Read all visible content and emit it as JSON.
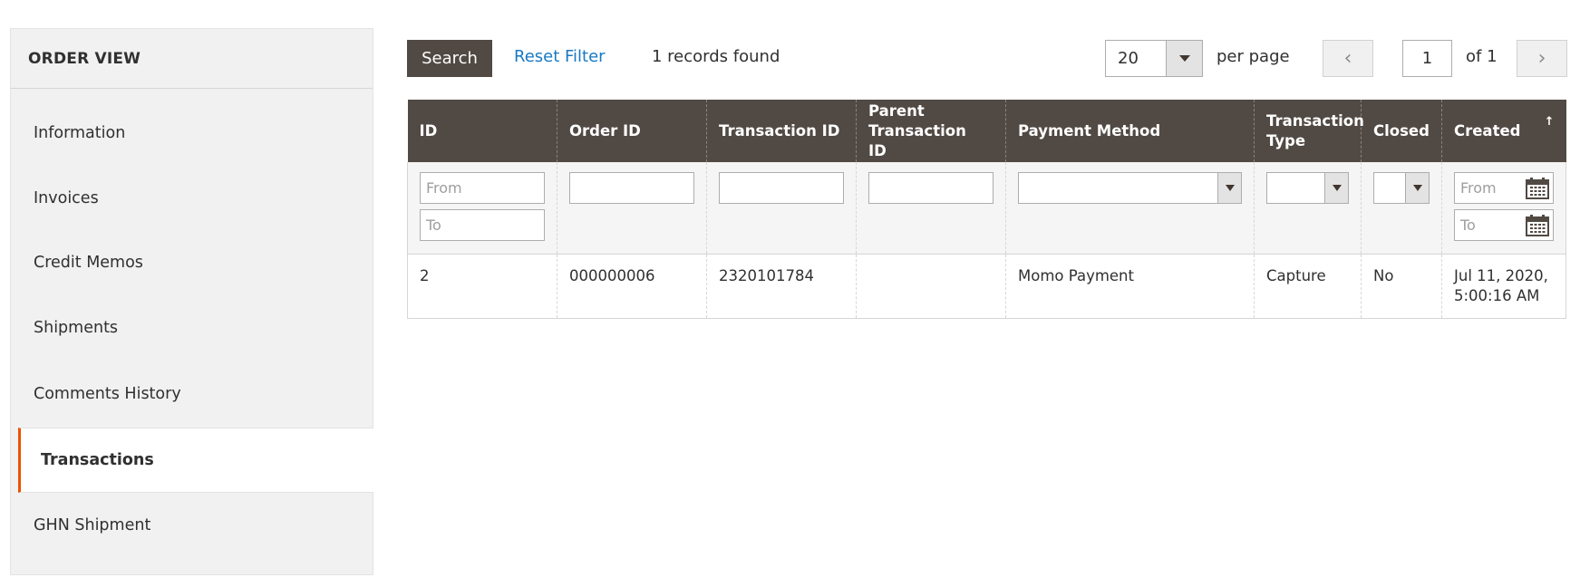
{
  "sidebar": {
    "title": "ORDER VIEW",
    "items": [
      {
        "label": "Information"
      },
      {
        "label": "Invoices"
      },
      {
        "label": "Credit Memos"
      },
      {
        "label": "Shipments"
      },
      {
        "label": "Comments History"
      },
      {
        "label": "Transactions",
        "active": true
      },
      {
        "label": "GHN Shipment"
      }
    ]
  },
  "toolbar": {
    "search_label": "Search",
    "reset_label": "Reset Filter",
    "records_found": "1 records found",
    "per_page_value": "20",
    "per_page_label": "per page",
    "prev_icon": "‹",
    "next_icon": "›",
    "current_page": "1",
    "of_pages": "of 1"
  },
  "grid": {
    "columns": [
      {
        "label": "ID"
      },
      {
        "label": "Order ID"
      },
      {
        "label": "Transaction ID"
      },
      {
        "label": "Parent Transaction ID"
      },
      {
        "label": "Payment Method"
      },
      {
        "label": "Transaction Type"
      },
      {
        "label": "Closed"
      },
      {
        "label": "Created"
      }
    ],
    "sort_indicator": "↑",
    "filters": {
      "id_from_placeholder": "From",
      "id_to_placeholder": "To",
      "created_from_placeholder": "From",
      "created_to_placeholder": "To"
    },
    "rows": [
      {
        "id": "2",
        "order_id": "000000006",
        "transaction_id": "2320101784",
        "parent_transaction_id": "",
        "payment_method": "Momo Payment",
        "transaction_type": "Capture",
        "closed": "No",
        "created_line1": "Jul 11, 2020,",
        "created_line2": "5:00:16 AM"
      }
    ]
  },
  "colors": {
    "header_bg": "#514943",
    "link": "#1979c3",
    "active_accent": "#eb5202",
    "sidebar_bg": "#f1f1f1"
  }
}
